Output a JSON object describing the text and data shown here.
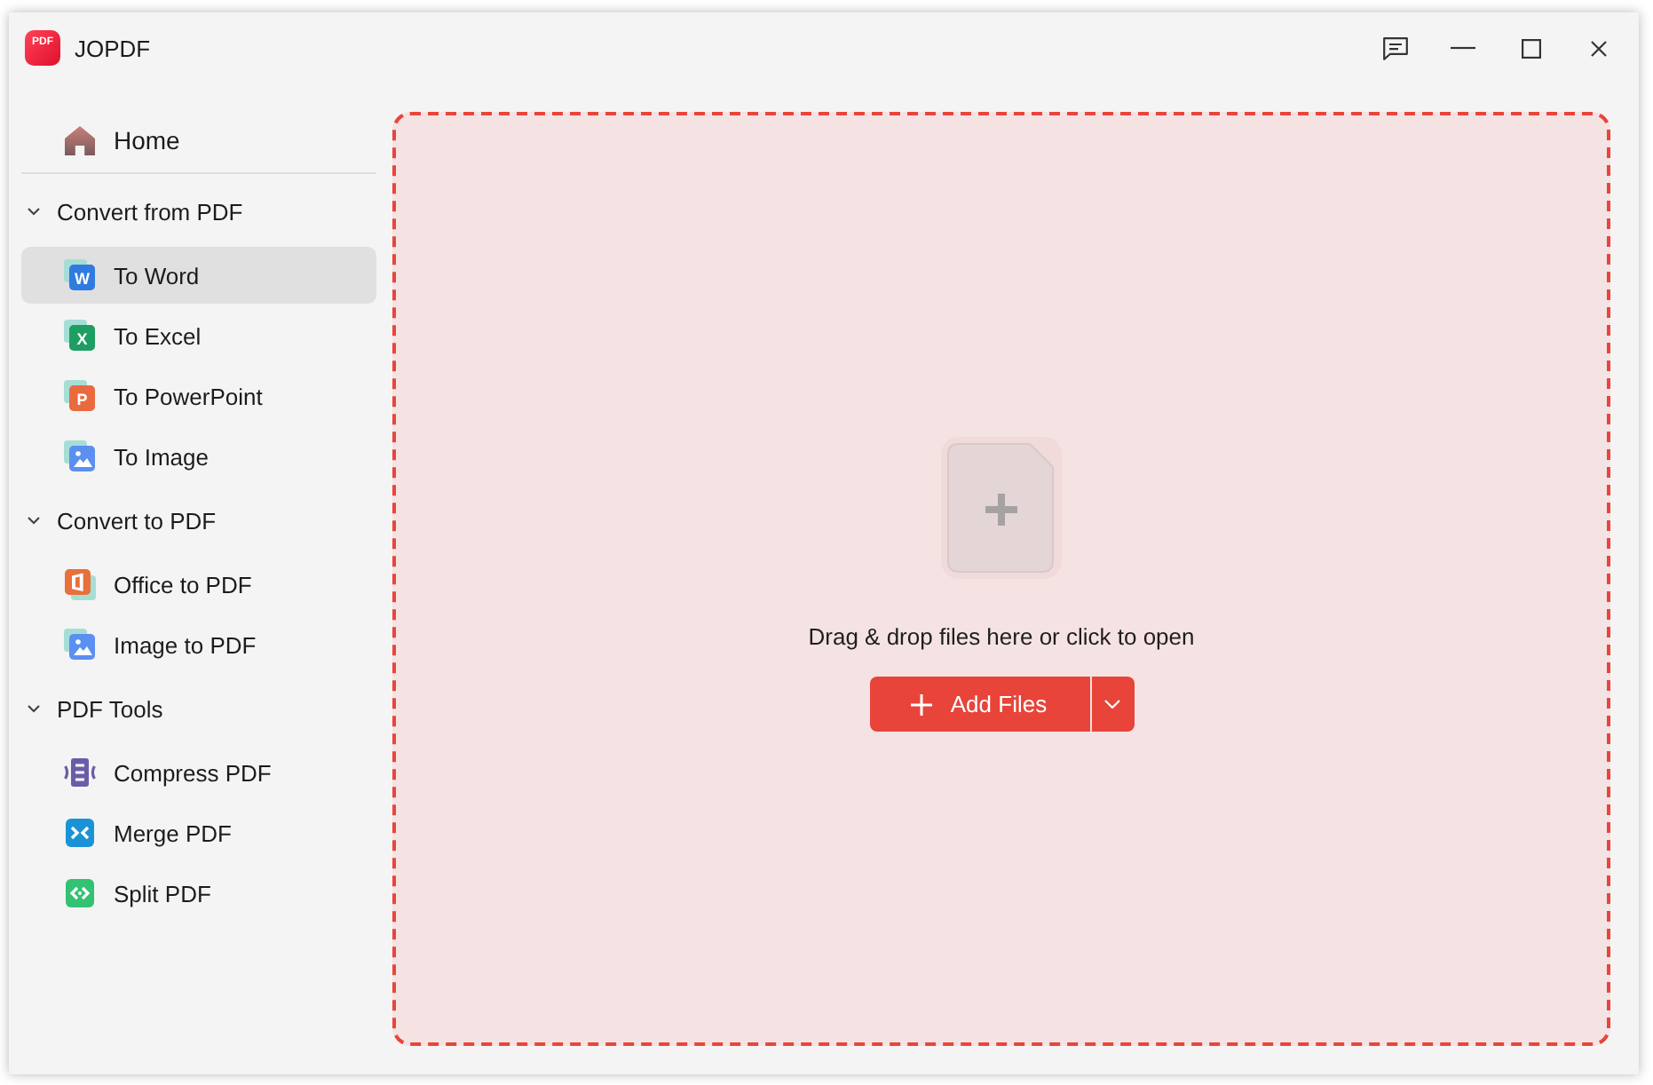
{
  "window": {
    "title": "JOPDF",
    "logo_text": "PDF"
  },
  "sidebar": {
    "home": {
      "label": "Home",
      "kind": "home",
      "selected": false
    },
    "groups": [
      {
        "label": "Convert from PDF",
        "expanded": true,
        "items": [
          {
            "label": "To Word",
            "kind": "word",
            "icon_letter": "W",
            "selected": true
          },
          {
            "label": "To Excel",
            "kind": "excel",
            "icon_letter": "X",
            "selected": false
          },
          {
            "label": "To PowerPoint",
            "kind": "powerpoint",
            "icon_letter": "P",
            "selected": false
          },
          {
            "label": "To Image",
            "kind": "image",
            "selected": false
          }
        ]
      },
      {
        "label": "Convert to PDF",
        "expanded": true,
        "items": [
          {
            "label": "Office to PDF",
            "kind": "office",
            "selected": false
          },
          {
            "label": "Image to PDF",
            "kind": "image",
            "selected": false
          }
        ]
      },
      {
        "label": "PDF Tools",
        "expanded": true,
        "items": [
          {
            "label": "Compress PDF",
            "kind": "compress",
            "selected": false
          },
          {
            "label": "Merge PDF",
            "kind": "merge",
            "selected": false
          },
          {
            "label": "Split PDF",
            "kind": "split",
            "selected": false
          }
        ]
      }
    ]
  },
  "drop_zone": {
    "message": "Drag & drop files here or click to open",
    "add_button": {
      "label": "Add Files"
    }
  }
}
